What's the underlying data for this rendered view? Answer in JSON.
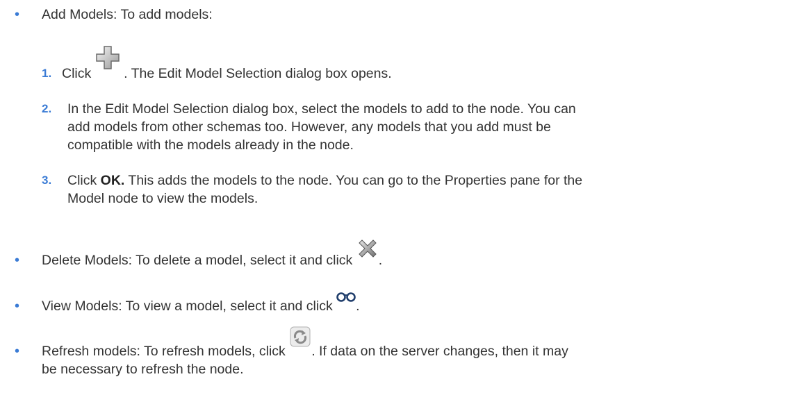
{
  "items": [
    {
      "lead": "Add Models: To add models:",
      "steps": [
        {
          "number": "1.",
          "before_icon": "Click ",
          "icon": "add-icon",
          "after_icon": ". The Edit Model Selection dialog box opens."
        },
        {
          "number": "2.",
          "lines": [
            "In the Edit Model Selection dialog box, select the models to add to the node. You can",
            "add models from other schemas too. However, any models that you add must be",
            "compatible with the models already in the node."
          ]
        },
        {
          "number": "3.",
          "bold": "OK.",
          "before_bold": "Click ",
          "line1_rest": " This adds the models to the node. You can go to the Properties pane for the",
          "line2": "Model node to view the models."
        }
      ]
    },
    {
      "before_icon": "Delete Models: To delete a model, select it and click ",
      "icon": "delete-icon",
      "after_icon": "."
    },
    {
      "before_icon": "View Models: To view a model, select it and click ",
      "icon": "view-glasses-icon",
      "after_icon": "."
    },
    {
      "before_icon": "Refresh models: To refresh models, click ",
      "icon": "refresh-icon",
      "after_icon": ". If data on the server changes, then it may",
      "line2": "be necessary to refresh the node."
    }
  ],
  "colors": {
    "text": "#333333",
    "bullet": "#3a7bd5"
  }
}
